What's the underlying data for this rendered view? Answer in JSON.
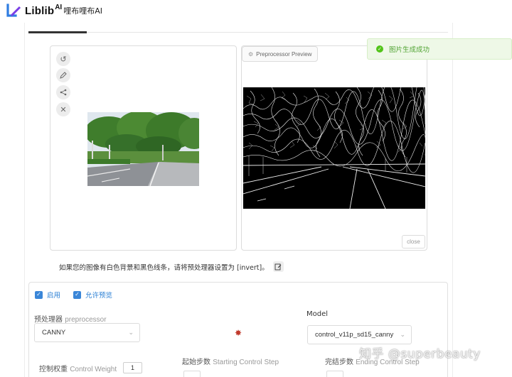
{
  "brand": {
    "name": "Liblib",
    "superscript": "AI",
    "chinese_name": "哩布哩布AI"
  },
  "toast": {
    "message": "图片生成成功",
    "icon": "check-circle-icon",
    "color": "#52c41a"
  },
  "preview": {
    "tab_label": "Preprocessor Preview",
    "close_label": "close"
  },
  "left_toolbar": {
    "icons": [
      "undo-icon",
      "pen-icon",
      "share-icon",
      "close-icon"
    ]
  },
  "hint": {
    "text": "如果您的图像有白色背景和黑色线条，请将预处理器设置为 [invert]。"
  },
  "settings": {
    "enable_label": "启用",
    "allow_preview_label": "允许预览",
    "preprocessor_label_cn": "预处理器",
    "preprocessor_label_en": "preprocessor",
    "preprocessor_value": "CANNY",
    "model_label": "Model",
    "model_value": "control_v11p_sd15_canny",
    "control_weight_label_cn": "控制权重",
    "control_weight_label_en": "Control Weight",
    "control_weight_value": "1",
    "starting_step_label_cn": "起始步数",
    "starting_step_label_en": "Starting Control Step",
    "ending_step_label_cn": "完结步数",
    "ending_step_label_en": "Ending Control Step"
  },
  "watermark": {
    "text": "知乎 @superbeauty"
  },
  "colors": {
    "accent": "#3a86d8",
    "success": "#52c41a"
  }
}
